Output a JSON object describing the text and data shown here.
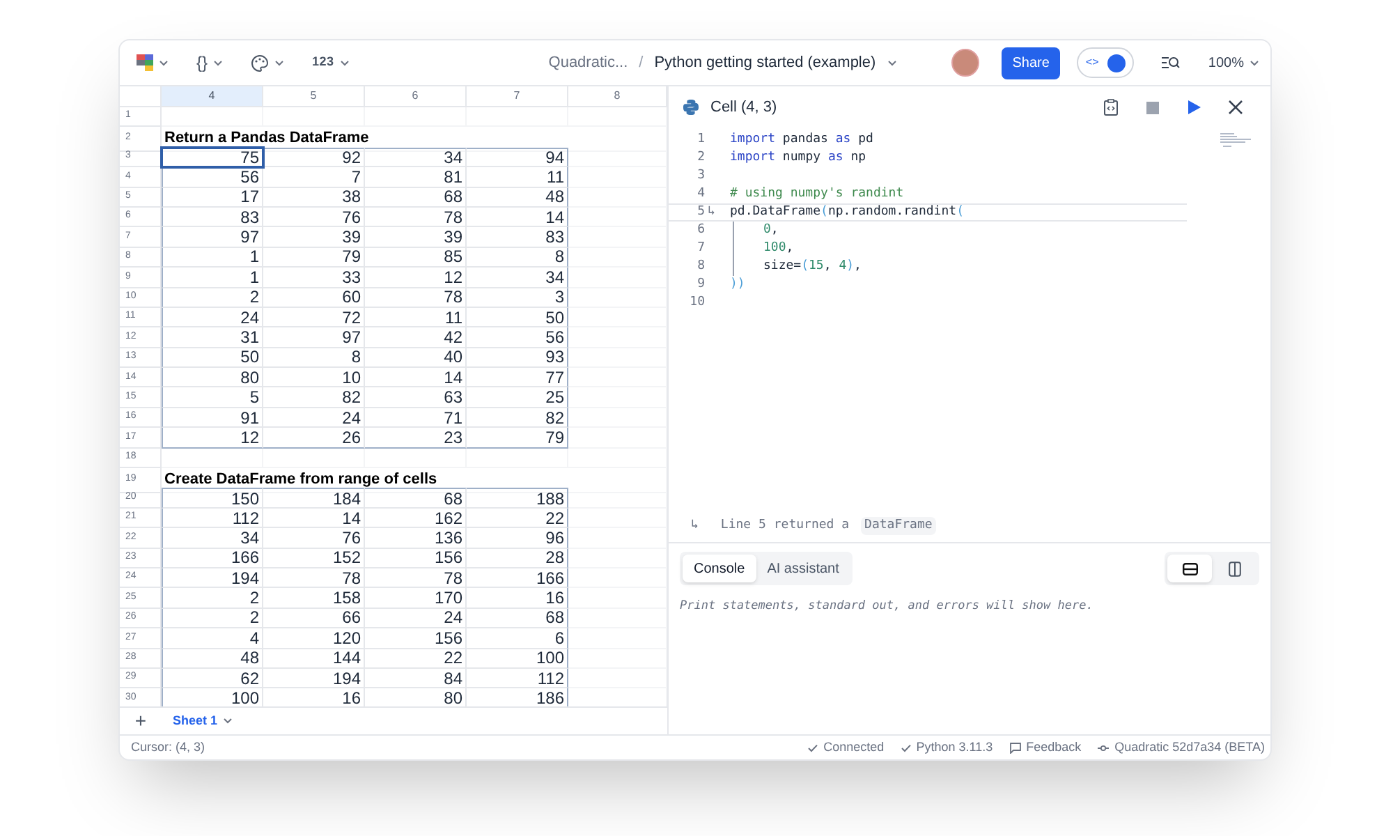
{
  "toolbar": {
    "menus": [
      {
        "kind": "logo"
      },
      {
        "kind": "code",
        "label": "{}"
      },
      {
        "kind": "palette"
      },
      {
        "kind": "number",
        "label": "123"
      }
    ],
    "breadcrumb": "Quadratic...",
    "separator": "/",
    "file_name": "Python getting started (example)",
    "share": "Share",
    "code_toggle": {
      "label": "<>",
      "on": true
    },
    "zoom": "100%"
  },
  "grid": {
    "columns": [
      {
        "label": "4",
        "selected": true
      },
      {
        "label": "5",
        "selected": false
      },
      {
        "label": "6",
        "selected": false
      },
      {
        "label": "7",
        "selected": false
      },
      {
        "label": "8",
        "selected": false
      }
    ],
    "rows": [
      {
        "kind": "empty",
        "number": "1"
      },
      {
        "kind": "title",
        "number": "2",
        "title": "Return a Pandas DataFrame"
      },
      {
        "kind": "data",
        "number": "3",
        "cursor": true,
        "cells": [
          "75",
          "92",
          "34",
          "94"
        ]
      },
      {
        "kind": "data",
        "number": "4",
        "cells": [
          "56",
          "7",
          "81",
          "11"
        ]
      },
      {
        "kind": "data",
        "number": "5",
        "cells": [
          "17",
          "38",
          "68",
          "48"
        ]
      },
      {
        "kind": "data",
        "number": "6",
        "cells": [
          "83",
          "76",
          "78",
          "14"
        ]
      },
      {
        "kind": "data",
        "number": "7",
        "cells": [
          "97",
          "39",
          "39",
          "83"
        ]
      },
      {
        "kind": "data",
        "number": "8",
        "cells": [
          "1",
          "79",
          "85",
          "8"
        ]
      },
      {
        "kind": "data",
        "number": "9",
        "cells": [
          "1",
          "33",
          "12",
          "34"
        ]
      },
      {
        "kind": "data",
        "number": "10",
        "cells": [
          "2",
          "60",
          "78",
          "3"
        ]
      },
      {
        "kind": "data",
        "number": "11",
        "cells": [
          "24",
          "72",
          "11",
          "50"
        ]
      },
      {
        "kind": "data",
        "number": "12",
        "cells": [
          "31",
          "97",
          "42",
          "56"
        ]
      },
      {
        "kind": "data",
        "number": "13",
        "cells": [
          "50",
          "8",
          "40",
          "93"
        ]
      },
      {
        "kind": "data",
        "number": "14",
        "cells": [
          "80",
          "10",
          "14",
          "77"
        ]
      },
      {
        "kind": "data",
        "number": "15",
        "cells": [
          "5",
          "82",
          "63",
          "25"
        ]
      },
      {
        "kind": "data",
        "number": "16",
        "cells": [
          "91",
          "24",
          "71",
          "82"
        ]
      },
      {
        "kind": "data",
        "number": "17",
        "cells": [
          "12",
          "26",
          "23",
          "79"
        ]
      },
      {
        "kind": "empty",
        "number": "18"
      },
      {
        "kind": "title",
        "number": "19",
        "title": "Create DataFrame from range of cells"
      },
      {
        "kind": "data",
        "number": "20",
        "cells": [
          "150",
          "184",
          "68",
          "188"
        ]
      },
      {
        "kind": "data",
        "number": "21",
        "cells": [
          "112",
          "14",
          "162",
          "22"
        ]
      },
      {
        "kind": "data",
        "number": "22",
        "cells": [
          "34",
          "76",
          "136",
          "96"
        ]
      },
      {
        "kind": "data",
        "number": "23",
        "cells": [
          "166",
          "152",
          "156",
          "28"
        ]
      },
      {
        "kind": "data",
        "number": "24",
        "cells": [
          "194",
          "78",
          "78",
          "166"
        ]
      },
      {
        "kind": "data",
        "number": "25",
        "cells": [
          "2",
          "158",
          "170",
          "16"
        ]
      },
      {
        "kind": "data",
        "number": "26",
        "cells": [
          "2",
          "66",
          "24",
          "68"
        ]
      },
      {
        "kind": "data",
        "number": "27",
        "cells": [
          "4",
          "120",
          "156",
          "6"
        ]
      },
      {
        "kind": "data",
        "number": "28",
        "cells": [
          "48",
          "144",
          "22",
          "100"
        ]
      },
      {
        "kind": "data",
        "number": "29",
        "cells": [
          "62",
          "194",
          "84",
          "112"
        ]
      },
      {
        "kind": "data",
        "number": "30",
        "cells": [
          "100",
          "16",
          "80",
          "186"
        ]
      }
    ]
  },
  "sheets": {
    "add": "+",
    "tabs": [
      {
        "label": "Sheet 1",
        "selected": true
      }
    ]
  },
  "editor": {
    "title": "Cell (4, 3)",
    "lines": [
      {
        "number": "1",
        "tokens": [
          {
            "kind": "keyword",
            "text": "import"
          },
          {
            "kind": "plain",
            "text": " pandas "
          },
          {
            "kind": "keyword",
            "text": "as"
          },
          {
            "kind": "plain",
            "text": " pd"
          }
        ]
      },
      {
        "number": "2",
        "tokens": [
          {
            "kind": "keyword",
            "text": "import"
          },
          {
            "kind": "plain",
            "text": " numpy "
          },
          {
            "kind": "keyword",
            "text": "as"
          },
          {
            "kind": "plain",
            "text": " np"
          }
        ]
      },
      {
        "number": "3"
      },
      {
        "number": "4",
        "tokens": [
          {
            "kind": "comment",
            "text": "# using numpy's randint"
          }
        ]
      },
      {
        "number": "5",
        "marker": "↳",
        "current": true,
        "tokens": [
          {
            "kind": "plain",
            "text": "pd.DataFrame"
          },
          {
            "kind": "bracket",
            "text": "("
          },
          {
            "kind": "plain",
            "text": "np.random.randint"
          },
          {
            "kind": "bracket",
            "text": "("
          }
        ]
      },
      {
        "number": "6",
        "indented": true,
        "tokens": [
          {
            "kind": "number",
            "text": "0"
          },
          {
            "kind": "plain",
            "text": ","
          }
        ]
      },
      {
        "number": "7",
        "indented": true,
        "tokens": [
          {
            "kind": "number",
            "text": "100"
          },
          {
            "kind": "plain",
            "text": ","
          }
        ]
      },
      {
        "number": "8",
        "indented": true,
        "tokens": [
          {
            "kind": "plain",
            "text": "size="
          },
          {
            "kind": "bracket",
            "text": "("
          },
          {
            "kind": "number",
            "text": "15"
          },
          {
            "kind": "plain",
            "text": ", "
          },
          {
            "kind": "number",
            "text": "4"
          },
          {
            "kind": "bracket",
            "text": ")"
          },
          {
            "kind": "plain",
            "text": ","
          }
        ]
      },
      {
        "number": "9",
        "tokens": [
          {
            "kind": "bracket",
            "text": "))"
          }
        ]
      },
      {
        "number": "10"
      }
    ],
    "result": {
      "marker": "↳",
      "text": "Line 5 returned a",
      "type": "DataFrame"
    }
  },
  "console": {
    "tabs": [
      {
        "label": "Console",
        "selected": true
      },
      {
        "label": "AI assistant",
        "selected": false
      }
    ],
    "layouts": [
      {
        "kind": "rows",
        "selected": true
      },
      {
        "kind": "columns",
        "selected": false
      }
    ],
    "empty_message": "Print statements, standard out, and errors will show here."
  },
  "status_bar": {
    "cursor": "Cursor: (4, 3)",
    "items": [
      {
        "kind": "check",
        "text": "Connected"
      },
      {
        "kind": "check",
        "text": "Python 3.11.3"
      },
      {
        "kind": "feedback",
        "text": "Feedback"
      },
      {
        "kind": "version",
        "text": "Quadratic 52d7a34 (BETA)"
      }
    ]
  }
}
